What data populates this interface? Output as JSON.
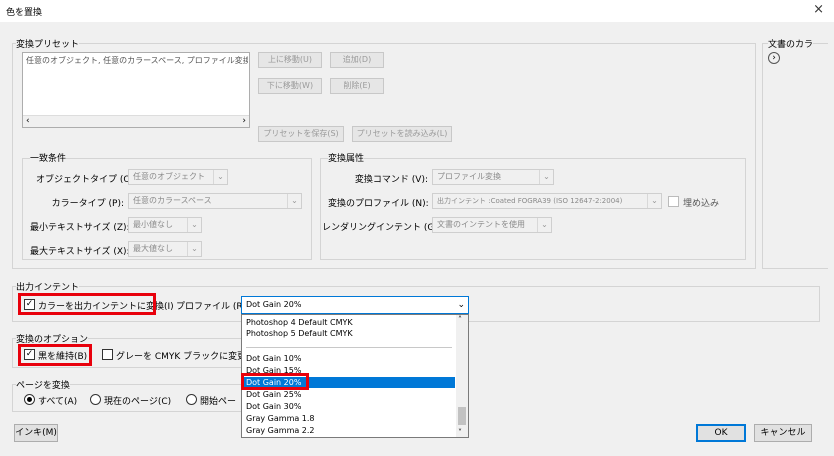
{
  "window": {
    "title": "色を置換",
    "close": "×"
  },
  "presets": {
    "group_label": "変換プリセット",
    "list_item": "任意のオブジェクト, 任意のカラースペース, プロファイル変換",
    "move_up": "上に移動(U)",
    "add": "追加(D)",
    "move_down": "下に移動(W)",
    "delete": "削除(E)",
    "save": "プリセットを保存(S)",
    "load": "プリセットを読み込み(L)"
  },
  "conditions": {
    "group_label": "一致条件",
    "object_type_label": "オブジェクトタイプ (O):",
    "object_type_value": "任意のオブジェクト",
    "color_type_label": "カラータイプ (P):",
    "color_type_value": "任意のカラースペース",
    "min_text_label": "最小テキストサイズ (Z):",
    "min_text_value": "最小値なし",
    "max_text_label": "最大テキストサイズ (X):",
    "max_text_value": "最大値なし"
  },
  "attributes": {
    "group_label": "変換属性",
    "command_label": "変換コマンド (V):",
    "command_value": "プロファイル変換",
    "profile_label": "変換のプロファイル (N):",
    "profile_value": "出力インテント :Coated FOGRA39 (ISO 12647-2:2004)",
    "embed_label": "埋め込み",
    "rendering_label": "レンダリングインテント (G):",
    "rendering_value": "文書のインテントを使用"
  },
  "doc_colors": {
    "label": "文書のカラ"
  },
  "output_intent": {
    "group_label": "出力インテント",
    "convert_label": "カラーを出力インテントに変換(I)",
    "convert_checked": true,
    "profile_label": "プロファイル (R):",
    "profile_value": "Dot Gain 20%"
  },
  "dropdown": {
    "items": [
      "Photoshop 4 Default CMYK",
      "Photoshop 5 Default CMYK",
      "",
      "Dot Gain 10%",
      "Dot Gain 15%",
      "Dot Gain 20%",
      "Dot Gain 25%",
      "Dot Gain 30%",
      "Gray Gamma 1.8",
      "Gray Gamma 2.2"
    ],
    "selected": "Dot Gain 20%"
  },
  "options": {
    "group_label": "変換のオプション",
    "keep_black_label": "黒を維持(B)",
    "keep_black_checked": true,
    "gray_label": "グレーを CMYK ブラックに変更(Y)"
  },
  "pages": {
    "group_label": "ページを変換",
    "all_label": "すべて(A)",
    "current_label": "現在のページ(C)",
    "start_label": "開始ペー"
  },
  "footer": {
    "ink": "インキ(M)",
    "ok": "OK",
    "cancel": "キャンセル"
  },
  "colors": {
    "accent": "#0078d7",
    "highlight_box": "#e8000c"
  }
}
